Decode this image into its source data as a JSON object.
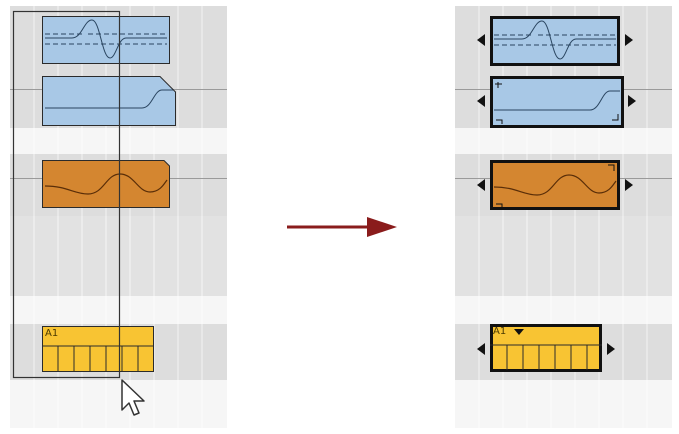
{
  "colors": {
    "audio_clip": "#a8c8e6",
    "orange_clip": "#d48630",
    "midi_clip": "#f8c433",
    "arrow": "#8a1c1c",
    "outline": "#2b2b2b"
  },
  "clips": {
    "midi_label": "A1"
  },
  "icons": {
    "cursor": "mouse-pointer-icon",
    "flow": "arrow-right-icon"
  }
}
